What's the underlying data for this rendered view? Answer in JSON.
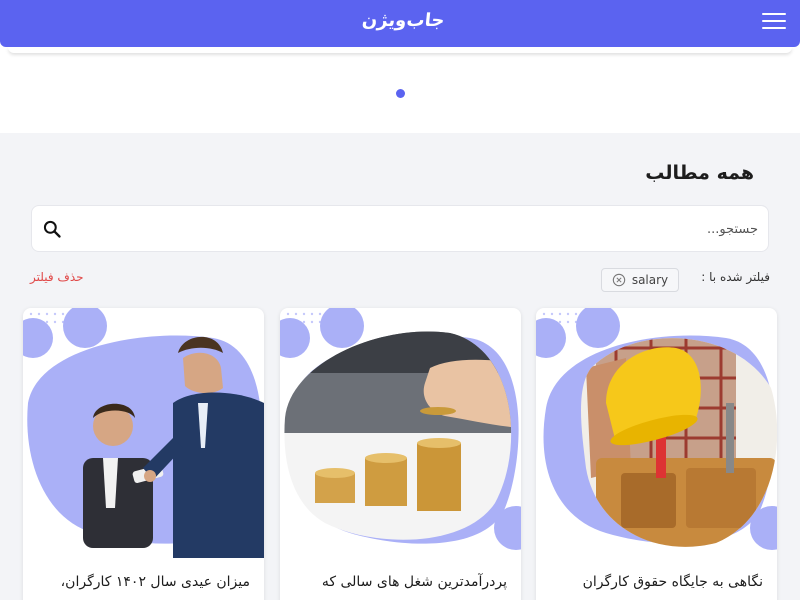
{
  "header": {
    "logo_text": "جاب‌ویژن",
    "menu_icon": "hamburger-menu-icon",
    "background": "#5b63f0"
  },
  "slider": {
    "active_dot_color": "#5b63f0"
  },
  "section": {
    "title": "همه مطالب"
  },
  "search": {
    "placeholder": "جستجو...",
    "value": "",
    "icon": "search-icon"
  },
  "filter": {
    "label": "فیلتر شده با :",
    "chip": "salary",
    "chip_icon": "close-circle-icon",
    "clear_label": "حذف فیلتر",
    "clear_color": "#e04848"
  },
  "cards": [
    {
      "title": "نگاهی به جایگاه حقوق کارگران",
      "image": "construction-worker-hardhat"
    },
    {
      "title": "پردرآمدترین شغل های سالی که",
      "image": "coin-stacks"
    },
    {
      "title": "میزان عیدی سال ۱۴۰۲ کارگران،",
      "image": "businessmen-handshake"
    }
  ],
  "colors": {
    "accent": "#5b63f0",
    "blob": "#aab0f7",
    "page_bg": "#f3f4f7"
  }
}
